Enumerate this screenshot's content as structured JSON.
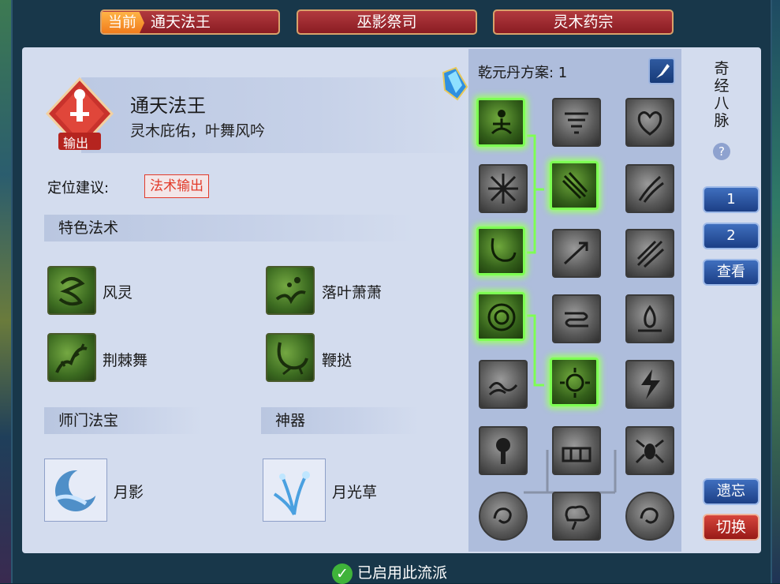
{
  "tabs": {
    "current_tag": "当前",
    "current_name": "通天法王",
    "tab2": "巫影祭司",
    "tab3": "灵木药宗"
  },
  "hero": {
    "badge": "输出",
    "name": "通天法王",
    "subtitle": "灵木庇佑，叶舞风吟",
    "role_label": "定位建议:",
    "role_value": "法术输出"
  },
  "sections": {
    "special_skills": "特色法术",
    "sect_treasure": "师门法宝",
    "artifact": "神器"
  },
  "skills": [
    {
      "name": "风灵",
      "icon": "swirl-icon"
    },
    {
      "name": "落叶萧萧",
      "icon": "falling-leaves-icon"
    },
    {
      "name": "荆棘舞",
      "icon": "thorns-icon"
    },
    {
      "name": "鞭挞",
      "icon": "whip-icon"
    }
  ],
  "treasures": [
    {
      "name": "月影",
      "icon": "moon-shadow-icon"
    },
    {
      "name": "月光草",
      "icon": "moonlight-grass-icon"
    }
  ],
  "plan": {
    "label": "乾元丹方案: 1"
  },
  "side": {
    "title": "奇经八脉",
    "help": "?",
    "btn1": "1",
    "btn2": "2",
    "view": "查看",
    "forget": "遗忘",
    "switch": "切换"
  },
  "footer": {
    "status": "已启用此流派"
  },
  "colors": {
    "tab_red": "#9a2228",
    "active_green": "#7dff53",
    "panel_bg": "#d3dcee",
    "role_red": "#e23a2a"
  }
}
